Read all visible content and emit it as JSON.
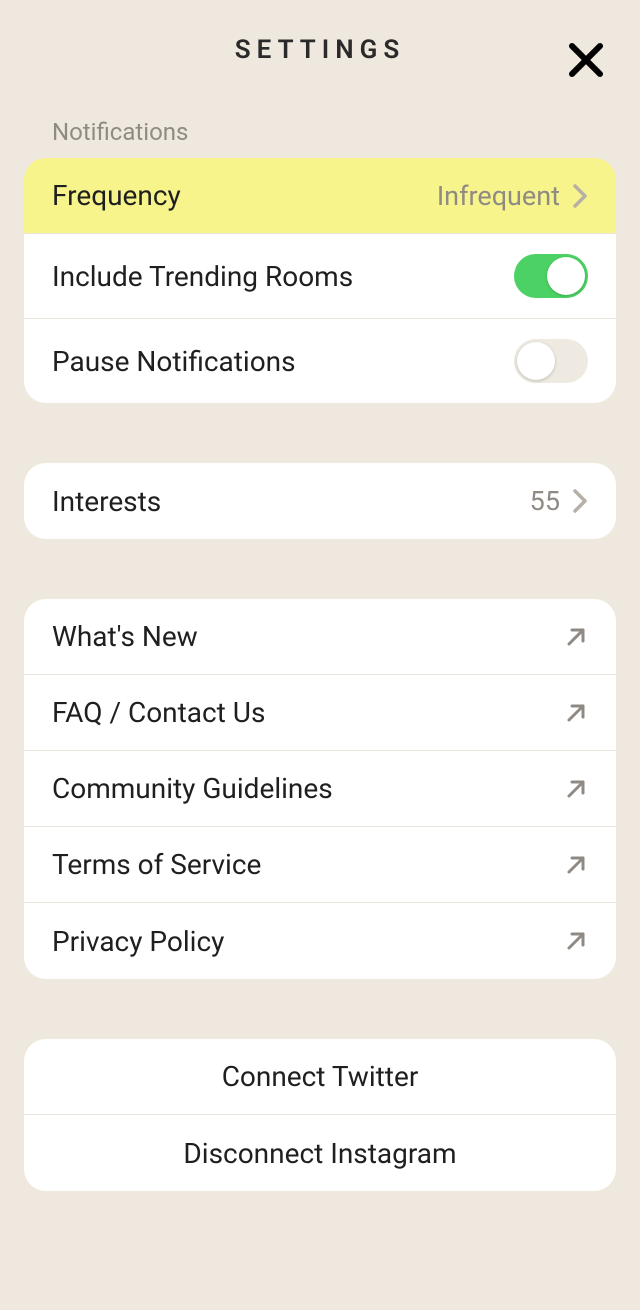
{
  "header": {
    "title": "SETTINGS"
  },
  "sections": {
    "notifications": {
      "label": "Notifications",
      "frequency": {
        "label": "Frequency",
        "value": "Infrequent"
      },
      "trending": {
        "label": "Include Trending Rooms",
        "on": true
      },
      "pause": {
        "label": "Pause Notifications",
        "on": false
      }
    },
    "interests": {
      "label": "Interests",
      "count": "55"
    },
    "links": {
      "whatsnew": "What's New",
      "faq": "FAQ / Contact Us",
      "community": "Community Guidelines",
      "tos": "Terms of Service",
      "privacy": "Privacy Policy"
    },
    "social": {
      "twitter": "Connect Twitter",
      "instagram": "Disconnect Instagram"
    }
  }
}
